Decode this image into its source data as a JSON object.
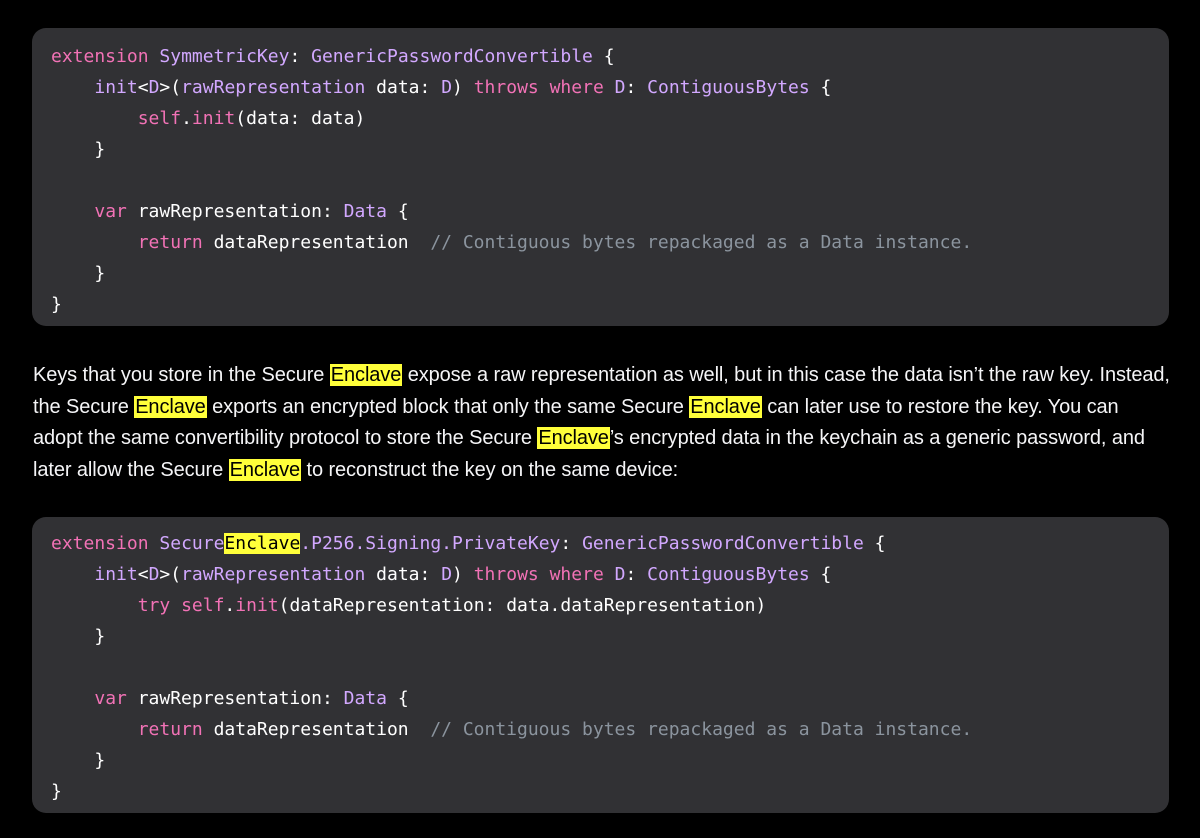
{
  "highlight_color": "#ffff3a",
  "code_blocks": [
    {
      "lines": [
        [
          {
            "t": "extension",
            "k": "kw"
          },
          {
            "t": " ",
            "k": "plain"
          },
          {
            "t": "SymmetricKey",
            "k": "type"
          },
          {
            "t": ": ",
            "k": "plain"
          },
          {
            "t": "GenericPasswordConvertible",
            "k": "type"
          },
          {
            "t": " {",
            "k": "plain"
          }
        ],
        [
          {
            "t": "    ",
            "k": "plain"
          },
          {
            "t": "init",
            "k": "type"
          },
          {
            "t": "<",
            "k": "plain"
          },
          {
            "t": "D",
            "k": "type"
          },
          {
            "t": ">(",
            "k": "plain"
          },
          {
            "t": "rawRepresentation",
            "k": "type"
          },
          {
            "t": " data: ",
            "k": "plain"
          },
          {
            "t": "D",
            "k": "type"
          },
          {
            "t": ") ",
            "k": "plain"
          },
          {
            "t": "throws",
            "k": "kw"
          },
          {
            "t": " ",
            "k": "plain"
          },
          {
            "t": "where",
            "k": "kw"
          },
          {
            "t": " ",
            "k": "plain"
          },
          {
            "t": "D",
            "k": "type"
          },
          {
            "t": ": ",
            "k": "plain"
          },
          {
            "t": "ContiguousBytes",
            "k": "type"
          },
          {
            "t": " {",
            "k": "plain"
          }
        ],
        [
          {
            "t": "        ",
            "k": "plain"
          },
          {
            "t": "self",
            "k": "kw"
          },
          {
            "t": ".",
            "k": "plain"
          },
          {
            "t": "init",
            "k": "kw"
          },
          {
            "t": "(data: data)",
            "k": "plain"
          }
        ],
        [
          {
            "t": "    }",
            "k": "plain"
          }
        ],
        [
          {
            "t": "",
            "k": "plain"
          }
        ],
        [
          {
            "t": "    ",
            "k": "plain"
          },
          {
            "t": "var",
            "k": "kw"
          },
          {
            "t": " rawRepresentation: ",
            "k": "plain"
          },
          {
            "t": "Data",
            "k": "type"
          },
          {
            "t": " {",
            "k": "plain"
          }
        ],
        [
          {
            "t": "        ",
            "k": "plain"
          },
          {
            "t": "return",
            "k": "kw"
          },
          {
            "t": " dataRepresentation  ",
            "k": "plain"
          },
          {
            "t": "// Contiguous bytes repackaged as a Data instance.",
            "k": "cm"
          }
        ],
        [
          {
            "t": "    }",
            "k": "plain"
          }
        ],
        [
          {
            "t": "}",
            "k": "plain"
          }
        ]
      ]
    },
    {
      "lines": [
        [
          {
            "t": "extension",
            "k": "kw"
          },
          {
            "t": " ",
            "k": "plain"
          },
          {
            "t": "Secure",
            "k": "type"
          },
          {
            "t": "Enclave",
            "k": "hl"
          },
          {
            "t": ".P256.Signing.PrivateKey",
            "k": "type"
          },
          {
            "t": ": ",
            "k": "plain"
          },
          {
            "t": "GenericPasswordConvertible",
            "k": "type"
          },
          {
            "t": " {",
            "k": "plain"
          }
        ],
        [
          {
            "t": "    ",
            "k": "plain"
          },
          {
            "t": "init",
            "k": "type"
          },
          {
            "t": "<",
            "k": "plain"
          },
          {
            "t": "D",
            "k": "type"
          },
          {
            "t": ">(",
            "k": "plain"
          },
          {
            "t": "rawRepresentation",
            "k": "type"
          },
          {
            "t": " data: ",
            "k": "plain"
          },
          {
            "t": "D",
            "k": "type"
          },
          {
            "t": ") ",
            "k": "plain"
          },
          {
            "t": "throws",
            "k": "kw"
          },
          {
            "t": " ",
            "k": "plain"
          },
          {
            "t": "where",
            "k": "kw"
          },
          {
            "t": " ",
            "k": "plain"
          },
          {
            "t": "D",
            "k": "type"
          },
          {
            "t": ": ",
            "k": "plain"
          },
          {
            "t": "ContiguousBytes",
            "k": "type"
          },
          {
            "t": " {",
            "k": "plain"
          }
        ],
        [
          {
            "t": "        ",
            "k": "plain"
          },
          {
            "t": "try",
            "k": "kw"
          },
          {
            "t": " ",
            "k": "plain"
          },
          {
            "t": "self",
            "k": "kw"
          },
          {
            "t": ".",
            "k": "plain"
          },
          {
            "t": "init",
            "k": "kw"
          },
          {
            "t": "(dataRepresentation: data.dataRepresentation)",
            "k": "plain"
          }
        ],
        [
          {
            "t": "    }",
            "k": "plain"
          }
        ],
        [
          {
            "t": "",
            "k": "plain"
          }
        ],
        [
          {
            "t": "    ",
            "k": "plain"
          },
          {
            "t": "var",
            "k": "kw"
          },
          {
            "t": " rawRepresentation: ",
            "k": "plain"
          },
          {
            "t": "Data",
            "k": "type"
          },
          {
            "t": " {",
            "k": "plain"
          }
        ],
        [
          {
            "t": "        ",
            "k": "plain"
          },
          {
            "t": "return",
            "k": "kw"
          },
          {
            "t": " dataRepresentation  ",
            "k": "plain"
          },
          {
            "t": "// Contiguous bytes repackaged as a Data instance.",
            "k": "cm"
          }
        ],
        [
          {
            "t": "    }",
            "k": "plain"
          }
        ],
        [
          {
            "t": "}",
            "k": "plain"
          }
        ]
      ]
    }
  ],
  "paragraph": [
    {
      "t": "Keys that you store in the Secure ",
      "hl": false
    },
    {
      "t": "Enclave",
      "hl": true
    },
    {
      "t": " expose a raw representation as well, but in this case the data isn’t the raw key. Instead, the Secure ",
      "hl": false
    },
    {
      "t": "Enclave",
      "hl": true
    },
    {
      "t": " exports an encrypted block that only the same Secure ",
      "hl": false
    },
    {
      "t": "Enclave",
      "hl": true
    },
    {
      "t": " can later use to restore the key. You can adopt the same convertibility protocol to store the Secure ",
      "hl": false
    },
    {
      "t": "Enclave",
      "hl": true
    },
    {
      "t": "’s encrypted data in the keychain as a generic password, and later allow the Secure ",
      "hl": false
    },
    {
      "t": "Enclave",
      "hl": true
    },
    {
      "t": " to reconstruct the key on the same device:",
      "hl": false
    }
  ]
}
